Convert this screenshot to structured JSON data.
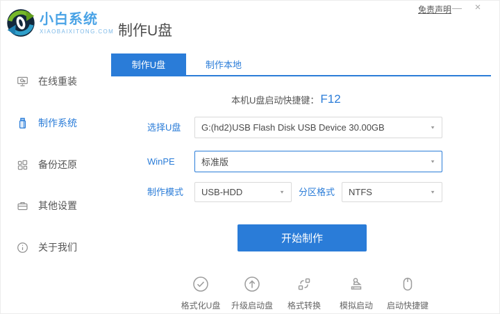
{
  "window": {
    "disclaimer": "免责声明",
    "minimize": "—",
    "close": "×"
  },
  "brand": {
    "name": "小白系统",
    "domain": "XIAOBAIXITONG.COM"
  },
  "header": {
    "title": "制作U盘"
  },
  "sidebar": {
    "items": [
      {
        "label": "在线重装",
        "icon": "monitor-reinstall-icon",
        "active": false
      },
      {
        "label": "制作系统",
        "icon": "usb-drive-icon",
        "active": true
      },
      {
        "label": "备份还原",
        "icon": "backup-restore-icon",
        "active": false
      },
      {
        "label": "其他设置",
        "icon": "settings-case-icon",
        "active": false
      },
      {
        "label": "关于我们",
        "icon": "info-icon",
        "active": false
      }
    ]
  },
  "tabs": [
    {
      "label": "制作U盘",
      "active": true
    },
    {
      "label": "制作本地",
      "active": false
    }
  ],
  "hotkey": {
    "prefix": "本机U盘启动快捷键：",
    "key": "F12"
  },
  "form": {
    "usb": {
      "label": "选择U盘",
      "value": "G:(hd2)USB Flash Disk USB Device 30.00GB"
    },
    "winpe": {
      "label": "WinPE",
      "value": "标准版"
    },
    "mode": {
      "label": "制作模式",
      "value": "USB-HDD"
    },
    "partition": {
      "label": "分区格式",
      "value": "NTFS"
    }
  },
  "actions": {
    "start": "开始制作"
  },
  "footer": {
    "items": [
      {
        "label": "格式化U盘",
        "icon": "check-circle-icon"
      },
      {
        "label": "升级启动盘",
        "icon": "upload-circle-icon"
      },
      {
        "label": "格式转换",
        "icon": "convert-icon"
      },
      {
        "label": "模拟启动",
        "icon": "stamp-icon"
      },
      {
        "label": "启动快捷键",
        "icon": "mouse-icon"
      }
    ]
  },
  "icons": {
    "caret": "▼"
  },
  "colors": {
    "primary": "#2a7cd8",
    "brand_blue": "#4aa3e6",
    "icon_gray": "#9c9c9c"
  }
}
